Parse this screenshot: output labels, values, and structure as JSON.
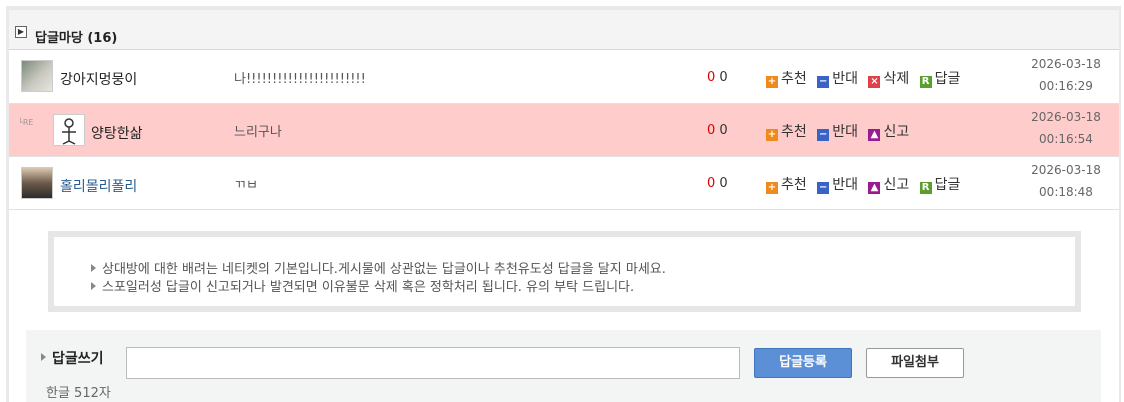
{
  "header": {
    "toggle_icon": "expand-icon",
    "title": "답글마당 (16)"
  },
  "comments": [
    {
      "nick": "강아지멍뭉이",
      "text": "나!!!!!!!!!!!!!!!!!!!!!!!",
      "up": "0",
      "down": "0",
      "actions": {
        "recommend": "추천",
        "oppose": "반대",
        "delete": "삭제",
        "reply": "답글"
      },
      "date": "2026-03-18",
      "time": "00:16:29"
    },
    {
      "reply_mark": "└RE",
      "nick": "양탕한삶",
      "text": "느리구나",
      "up": "0",
      "down": "0",
      "actions": {
        "recommend": "추천",
        "oppose": "반대",
        "report": "신고"
      },
      "date": "2026-03-18",
      "time": "00:16:54"
    },
    {
      "nick": "홀리몰리폴리",
      "text": "ㄲㅂ",
      "up": "0",
      "down": "0",
      "actions": {
        "recommend": "추천",
        "oppose": "반대",
        "report": "신고",
        "reply": "답글"
      },
      "date": "2026-03-18",
      "time": "00:18:48"
    }
  ],
  "notice": {
    "lines": [
      "상대방에 대한 배려는 네티켓의 기본입니다.게시물에 상관없는 답글이나 추천유도성 답글을 달지 마세요.",
      "스포일러성 답글이 신고되거나 발견되면 이유불문 삭제 혹은 정학처리 됩니다. 유의 부탁 드립니다."
    ]
  },
  "write": {
    "label": "답글쓰기",
    "limit": "한글 512자",
    "input_value": "",
    "submit_label": "답글등록",
    "attach_label": "파일첨부"
  },
  "colors": {
    "highlight_row": "#ffcccc",
    "recommend": "#f08a1c",
    "oppose": "#3a63c8",
    "delete": "#e0404a",
    "reply": "#5b9e2e",
    "report": "#9a1b8f",
    "submit_button": "#5b8fd6"
  }
}
